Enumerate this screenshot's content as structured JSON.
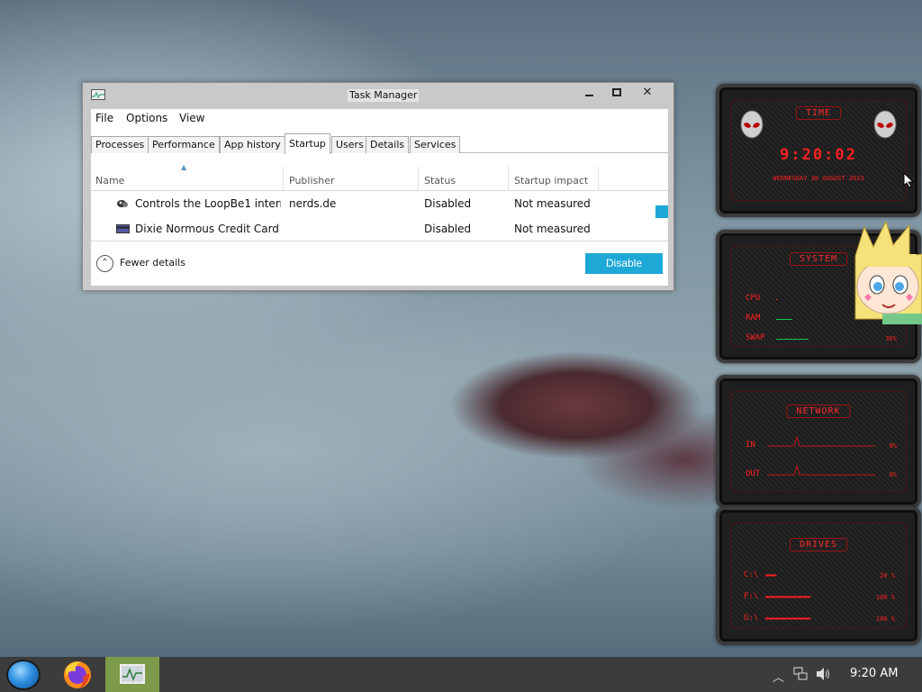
{
  "task_manager": {
    "title": "Task Manager",
    "menu": [
      "File",
      "Options",
      "View"
    ],
    "tabs": [
      "Processes",
      "Performance",
      "App history",
      "Startup",
      "Users",
      "Details",
      "Services"
    ],
    "active_tab": "Startup",
    "columns": [
      "Name",
      "Publisher",
      "Status",
      "Startup impact"
    ],
    "rows": [
      {
        "name": "Controls the LoopBe1 intern...",
        "publisher": "nerds.de",
        "status": "Disabled",
        "impact": "Not measured"
      },
      {
        "name": "Dixie Normous Credit Card S...",
        "publisher": "",
        "status": "Disabled",
        "impact": "Not measured"
      }
    ],
    "fewer_details": "Fewer details",
    "disable_button": "Disable",
    "accent_color": "#1ea8d6"
  },
  "widgets": {
    "time": {
      "title": "TIME",
      "clock": "9:20:02",
      "date": "WEDNESDAY 30 AUGUST 2023"
    },
    "system": {
      "title": "SYSTEM",
      "cpu_label": "CPU",
      "ram_label": "RAM",
      "swap_label": "SWAP",
      "swap_value": "36%"
    },
    "network": {
      "title": "NETWORK",
      "in_label": "IN",
      "in_value": "0%",
      "out_label": "OUT",
      "out_value": "0%"
    },
    "drives": {
      "title": "DRIVES",
      "items": [
        {
          "label": "C:\\",
          "value": "26 %"
        },
        {
          "label": "F:\\",
          "value": "100 %"
        },
        {
          "label": "G:\\",
          "value": "100 %"
        }
      ]
    },
    "accent_color": "#ff2020"
  },
  "taskbar": {
    "clock": "9:20 AM",
    "apps": [
      "start-orb-icon",
      "firefox-icon",
      "task-manager-icon"
    ],
    "tray": [
      "chevron-up-icon",
      "network-icon",
      "volume-icon"
    ]
  }
}
